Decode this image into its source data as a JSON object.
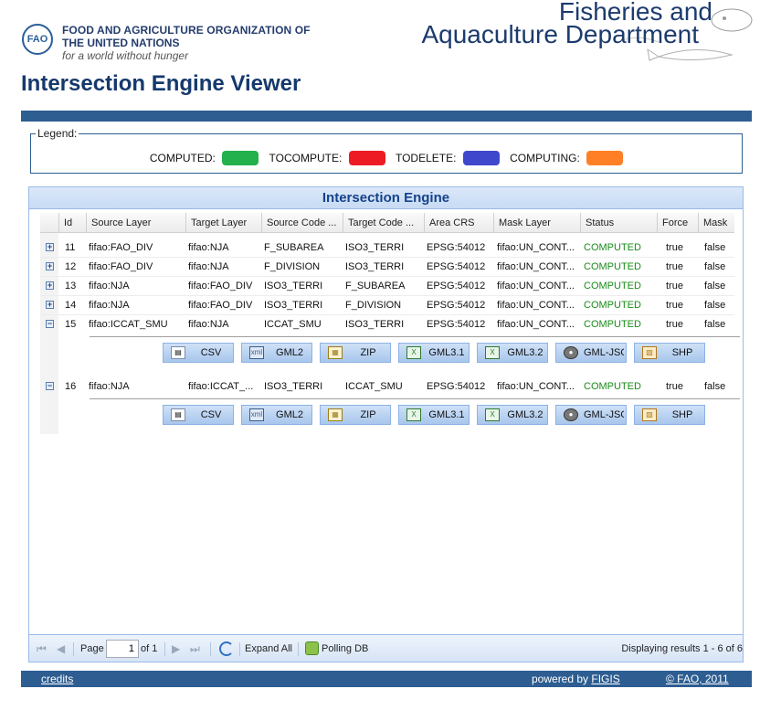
{
  "header": {
    "org_line1": "FOOD AND AGRICULTURE ORGANIZATION OF",
    "org_line2": "THE UNITED NATIONS",
    "org_tagline": "for a world without hunger",
    "dept_line1": "Fisheries and",
    "dept_line2": "Aquaculture Department"
  },
  "page_title": "Intersection Engine Viewer",
  "legend": {
    "title": "Legend:",
    "items": [
      {
        "label": "COMPUTED:",
        "color": "#22b14c"
      },
      {
        "label": "TOCOMPUTE:",
        "color": "#ed1c24"
      },
      {
        "label": "TODELETE:",
        "color": "#3f48cc"
      },
      {
        "label": "COMPUTING:",
        "color": "#ff7f27"
      }
    ]
  },
  "grid": {
    "title": "Intersection Engine",
    "columns": [
      "Id",
      "Source Layer",
      "Target Layer",
      "Source Code ...",
      "Target Code ...",
      "Area CRS",
      "Mask Layer",
      "Status",
      "Force",
      "Mask"
    ],
    "rows": [
      {
        "expander": "+",
        "id": "11",
        "source": "fifao:FAO_DIV",
        "target": "fifao:NJA",
        "source_code": "F_SUBAREA",
        "target_code": "ISO3_TERRI",
        "crs": "EPSG:54012",
        "mask_layer": "fifao:UN_CONT...",
        "status": "COMPUTED",
        "force": "true",
        "mask": "false"
      },
      {
        "expander": "+",
        "id": "12",
        "source": "fifao:FAO_DIV",
        "target": "fifao:NJA",
        "source_code": "F_DIVISION",
        "target_code": "ISO3_TERRI",
        "crs": "EPSG:54012",
        "mask_layer": "fifao:UN_CONT...",
        "status": "COMPUTED",
        "force": "true",
        "mask": "false"
      },
      {
        "expander": "+",
        "id": "13",
        "source": "fifao:NJA",
        "target": "fifao:FAO_DIV",
        "source_code": "ISO3_TERRI",
        "target_code": "F_SUBAREA",
        "crs": "EPSG:54012",
        "mask_layer": "fifao:UN_CONT...",
        "status": "COMPUTED",
        "force": "true",
        "mask": "false"
      },
      {
        "expander": "+",
        "id": "14",
        "source": "fifao:NJA",
        "target": "fifao:FAO_DIV",
        "source_code": "ISO3_TERRI",
        "target_code": "F_DIVISION",
        "crs": "EPSG:54012",
        "mask_layer": "fifao:UN_CONT...",
        "status": "COMPUTED",
        "force": "true",
        "mask": "false"
      },
      {
        "expander": "−",
        "id": "15",
        "source": "fifao:ICCAT_SMU",
        "target": "fifao:NJA",
        "source_code": "ICCAT_SMU",
        "target_code": "ISO3_TERRI",
        "crs": "EPSG:54012",
        "mask_layer": "fifao:UN_CONT...",
        "status": "COMPUTED",
        "force": "true",
        "mask": "false"
      },
      {
        "expander": "−",
        "id": "16",
        "source": "fifao:NJA",
        "target": "fifao:ICCAT_...",
        "source_code": "ISO3_TERRI",
        "target_code": "ICCAT_SMU",
        "crs": "EPSG:54012",
        "mask_layer": "fifao:UN_CONT...",
        "status": "COMPUTED",
        "force": "true",
        "mask": "false"
      }
    ],
    "download_buttons": [
      {
        "label": "CSV",
        "icon": "csv-icon"
      },
      {
        "label": "GML2",
        "icon": "gml-icon"
      },
      {
        "label": "ZIP",
        "icon": "zip-icon"
      },
      {
        "label": "GML3.1",
        "icon": "excel-icon"
      },
      {
        "label": "GML3.2",
        "icon": "excel-icon"
      },
      {
        "label": "GML-JSO",
        "icon": "globe-icon"
      },
      {
        "label": "SHP",
        "icon": "shp-icon"
      }
    ]
  },
  "paging": {
    "page_label": "Page",
    "page_value": "1",
    "of_label": "of 1",
    "expand_all": "Expand All",
    "polling": "Polling DB",
    "display_text": "Displaying results 1 - 6 of 6"
  },
  "footer": {
    "credits": "credits",
    "powered_prefix": "powered by ",
    "powered_link": "FIGIS",
    "copyright": "© FAO, 2011"
  }
}
